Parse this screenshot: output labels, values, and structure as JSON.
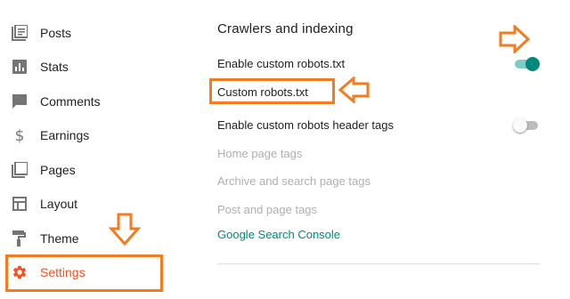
{
  "sidebar": {
    "items": [
      {
        "label": "Posts",
        "icon": "posts-icon"
      },
      {
        "label": "Stats",
        "icon": "stats-icon"
      },
      {
        "label": "Comments",
        "icon": "comments-icon"
      },
      {
        "label": "Earnings",
        "icon": "dollar-icon"
      },
      {
        "label": "Pages",
        "icon": "pages-icon"
      },
      {
        "label": "Layout",
        "icon": "layout-icon"
      },
      {
        "label": "Theme",
        "icon": "paint-roller-icon"
      },
      {
        "label": "Settings",
        "icon": "gear-icon",
        "active": true
      }
    ]
  },
  "main": {
    "section_title": "Crawlers and indexing",
    "enable_robots_label": "Enable custom robots.txt",
    "enable_robots_on": true,
    "custom_robots_label": "Custom robots.txt",
    "enable_header_tags_label": "Enable custom robots header tags",
    "enable_header_tags_on": false,
    "home_tags_label": "Home page tags",
    "archive_tags_label": "Archive and search page tags",
    "post_tags_label": "Post and page tags",
    "search_console_label": "Google Search Console"
  },
  "colors": {
    "accent": "#f4511e",
    "annotation_orange": "#f47b20",
    "teal": "#00897b",
    "disabled_text": "#b0b0b0"
  }
}
